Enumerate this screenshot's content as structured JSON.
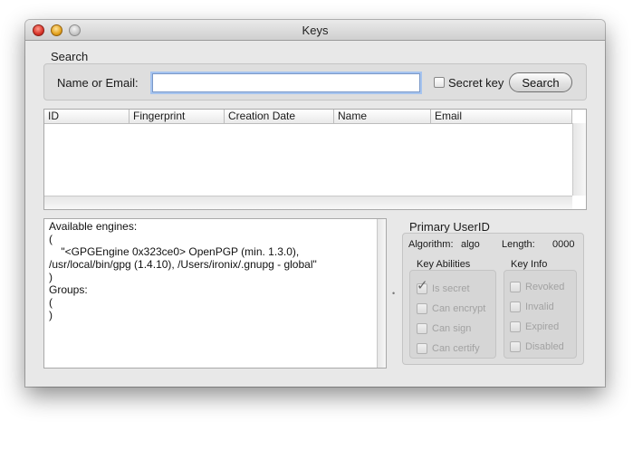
{
  "window": {
    "title": "Keys"
  },
  "search": {
    "group_title": "Search",
    "name_label": "Name or Email:",
    "input_value": "",
    "secret_key_label": "Secret key",
    "button_label": "Search"
  },
  "table": {
    "columns": [
      "ID",
      "Fingerprint",
      "Creation Date",
      "Name",
      "Email"
    ],
    "rows": []
  },
  "engines_text": "Available engines:\n(\n    \"<GPGEngine 0x323ce0> OpenPGP (min. 1.3.0), /usr/local/bin/gpg (1.4.10), /Users/ironix/.gnupg - global\"\n)\nGroups:\n(\n)",
  "primary": {
    "title": "Primary UserID",
    "algorithm_label": "Algorithm:",
    "algorithm_value": "algo",
    "length_label": "Length:",
    "length_value": "0000",
    "abilities": {
      "title": "Key Abilities",
      "items": [
        {
          "label": "Is secret",
          "checked": true
        },
        {
          "label": "Can encrypt",
          "checked": false
        },
        {
          "label": "Can sign",
          "checked": false
        },
        {
          "label": "Can certify",
          "checked": false
        }
      ]
    },
    "info": {
      "title": "Key Info",
      "items": [
        {
          "label": "Revoked",
          "checked": false
        },
        {
          "label": "Invalid",
          "checked": false
        },
        {
          "label": "Expired",
          "checked": false
        },
        {
          "label": "Disabled",
          "checked": false
        }
      ]
    }
  }
}
